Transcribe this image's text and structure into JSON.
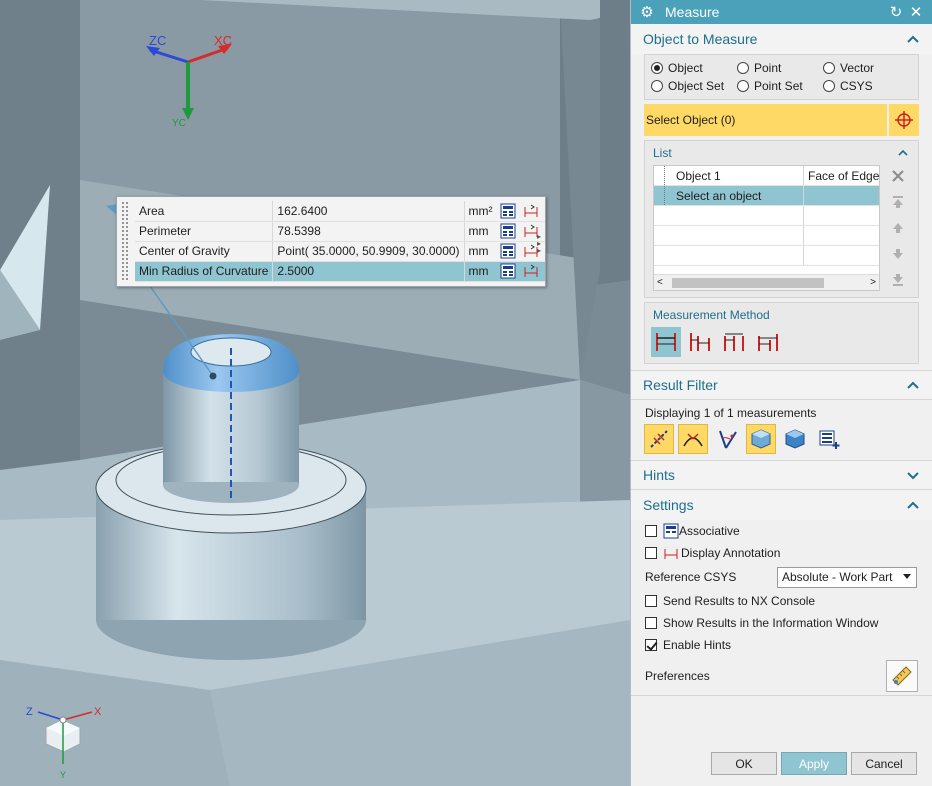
{
  "viewport": {
    "triad_top": {
      "zc": "ZC",
      "xc": "XC",
      "yc": "YC"
    },
    "triad_bottom": {
      "z": "Z",
      "x": "X",
      "y": "Y"
    }
  },
  "results": {
    "rows": [
      {
        "name": "Area",
        "value": "162.6400",
        "unit": "mm²"
      },
      {
        "name": "Perimeter",
        "value": "78.5398",
        "unit": "mm"
      },
      {
        "name": "Center of Gravity",
        "value": "Point( 35.0000, 50.9909, 30.0000)",
        "unit": "mm"
      },
      {
        "name": "Min Radius of Curvature",
        "value": "2.5000",
        "unit": "mm"
      }
    ]
  },
  "dialog": {
    "title": "Measure",
    "object_to_measure": {
      "heading": "Object to Measure",
      "options": [
        "Object",
        "Point",
        "Vector",
        "Object Set",
        "Point Set",
        "CSYS"
      ],
      "selected": "Object",
      "select_label": "Select Object (0)",
      "list": {
        "heading": "List",
        "col1": "Object 1",
        "col2": "Face of Edge",
        "row1": "Select an object"
      },
      "method_heading": "Measurement Method"
    },
    "result_filter": {
      "heading": "Result Filter",
      "status": "Displaying 1 of 1 measurements"
    },
    "hints": {
      "heading": "Hints"
    },
    "settings": {
      "heading": "Settings",
      "associative": "Associative",
      "display_annotation": "Display Annotation",
      "ref_csys_label": "Reference CSYS",
      "ref_csys_value": "Absolute - Work Part",
      "send_nx": "Send Results to NX Console",
      "show_info": "Show Results in the Information Window",
      "enable_hints": "Enable Hints",
      "preferences": "Preferences"
    },
    "buttons": {
      "ok": "OK",
      "apply": "Apply",
      "cancel": "Cancel"
    }
  }
}
